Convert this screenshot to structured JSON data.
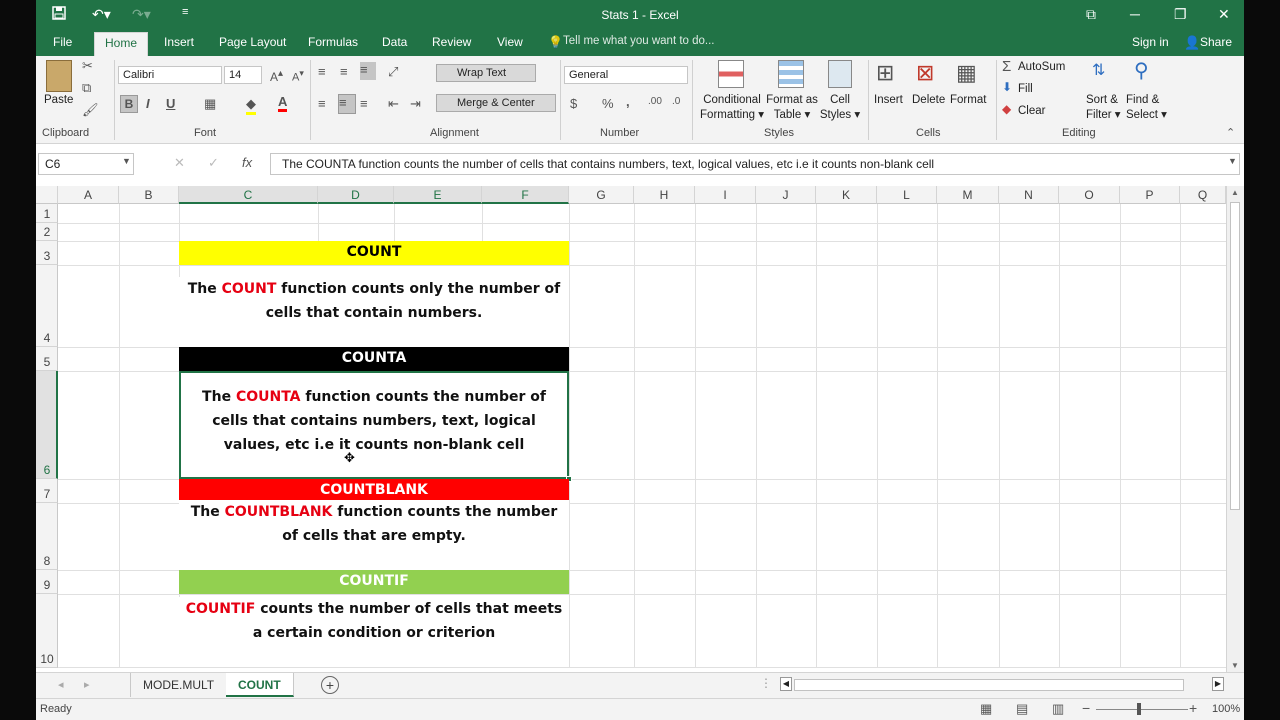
{
  "window": {
    "title": "Stats 1 - Excel",
    "qa_save_icon": "save-icon",
    "controls": {
      "ribbon_options": "⧉",
      "minimize": "─",
      "restore": "❐",
      "close": "✕"
    }
  },
  "ribbon_tabs": [
    "File",
    "Home",
    "Insert",
    "Page Layout",
    "Formulas",
    "Data",
    "Review",
    "View"
  ],
  "tell_me": "Tell me what you want to do...",
  "account": {
    "sign_in": "Sign in",
    "share": "Share"
  },
  "ribbon": {
    "clipboard": {
      "paste": "Paste",
      "label": "Clipboard"
    },
    "font": {
      "name": "Calibri",
      "size": "14",
      "bold": "B",
      "italic": "I",
      "underline": "U",
      "label": "Font"
    },
    "alignment": {
      "wrap_text": "Wrap Text",
      "merge_center": "Merge & Center",
      "label": "Alignment"
    },
    "number": {
      "format": "General",
      "currency": "$",
      "percent": "%",
      "comma": ",",
      "label": "Number"
    },
    "styles": {
      "conditional_l1": "Conditional",
      "conditional_l2": "Formatting",
      "format_table_l1": "Format as",
      "format_table_l2": "Table",
      "cell_styles_l1": "Cell",
      "cell_styles_l2": "Styles",
      "label": "Styles"
    },
    "cells": {
      "insert": "Insert",
      "delete": "Delete",
      "format": "Format",
      "label": "Cells"
    },
    "editing": {
      "autosum": "AutoSum",
      "fill": "Fill",
      "clear": "Clear",
      "sort_l1": "Sort &",
      "sort_l2": "Filter",
      "find_l1": "Find &",
      "find_l2": "Select",
      "label": "Editing"
    }
  },
  "formula_bar": {
    "name_box": "C6",
    "fx": "fx",
    "content": "The COUNTA function counts the number of cells that contains numbers, text, logical values, etc i.e it counts non-blank cell"
  },
  "columns": [
    "A",
    "B",
    "C",
    "D",
    "E",
    "F",
    "G",
    "H",
    "I",
    "J",
    "K",
    "L",
    "M",
    "N",
    "O",
    "P",
    "Q"
  ],
  "rows": [
    "1",
    "2",
    "3",
    "4",
    "5",
    "6",
    "7",
    "8",
    "9",
    "10"
  ],
  "sheet": {
    "count": {
      "header": "COUNT",
      "pre": "The ",
      "keyword": "COUNT",
      "post": " function counts only the number of cells that contain numbers."
    },
    "counta": {
      "header": "COUNTA",
      "pre": "The ",
      "keyword": "COUNTA",
      "post": " function counts the number of cells that contains numbers, text, logical values, etc i.e it counts non-blank cell"
    },
    "countblank": {
      "header": "COUNTBLANK",
      "pre": "The ",
      "keyword": "COUNTBLANK",
      "post": " function counts the number of cells that are empty."
    },
    "countif": {
      "header": "COUNTIF",
      "pre": "",
      "keyword": "COUNTIF",
      "post": " counts the number of cells that meets a certain condition or criterion"
    }
  },
  "colors": {
    "excel_green": "#217346",
    "count_header": "#ffff00",
    "counta_header": "#000000",
    "countblank_header": "#ff0000",
    "countif_header": "#92d050",
    "keyword_red": "#e60012"
  },
  "sheet_tabs": [
    "MODE.MULT",
    "COUNT"
  ],
  "active_sheet": "COUNT",
  "status": {
    "ready": "Ready",
    "zoom": "100%"
  }
}
